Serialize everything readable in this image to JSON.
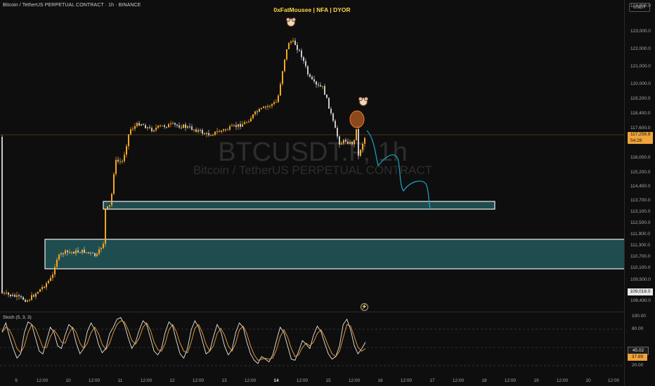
{
  "chart_header": {
    "symbol_title": "Bitcoin / TetherUS PERPETUAL CONTRACT · 1h · BINANCE",
    "author_header": "0xFatMousee | NFA | DYOR",
    "watermark_symbol": "BTCUSDT.P, 1h",
    "watermark_name": "Bitcoin / TetherUS PERPETUAL CONTRACT"
  },
  "price_axis": {
    "currency": "USDT",
    "ticks": [
      "124,000.0",
      "123,000.0",
      "122,000.0",
      "121,000.0",
      "120,000.0",
      "119,200.0",
      "118,400.0",
      "117,600.0",
      "116,800.0",
      "116,000.0",
      "115,200.0",
      "114,450.0",
      "113,700.0",
      "113,100.0",
      "112,500.0",
      "111,900.0",
      "111,300.0",
      "110,700.0",
      "110,100.0",
      "109,500.0",
      "108,430.0"
    ],
    "last_price": "117,256.8",
    "countdown": "54:28",
    "low_label": "109,018.0"
  },
  "stoch": {
    "title": "Stoch (5, 3, 3)",
    "ticks": [
      "100.00",
      "80.00",
      "20.00"
    ],
    "k_value": "45.02",
    "d_value": "37.89",
    "k_series": [
      72,
      88,
      62,
      40,
      22,
      30,
      70,
      90,
      85,
      60,
      35,
      30,
      55,
      80,
      70,
      45,
      40,
      65,
      85,
      78,
      50,
      30,
      40,
      72,
      88,
      75,
      48,
      32,
      40,
      68,
      80,
      95,
      98,
      85,
      60,
      40,
      52,
      75,
      92,
      85,
      60,
      35,
      28,
      40,
      70,
      90,
      82,
      55,
      30,
      22,
      40,
      75,
      92,
      80,
      55,
      30,
      35,
      62,
      85,
      72,
      45,
      28,
      38,
      70,
      88,
      80,
      52,
      30,
      18,
      12,
      25,
      20,
      15,
      28,
      55,
      80,
      70,
      45,
      20,
      18,
      35,
      55,
      48,
      40,
      65,
      82,
      72,
      50,
      30,
      20,
      25,
      45,
      85,
      95,
      75,
      45,
      30,
      40,
      52
    ],
    "d_series": [
      70,
      80,
      75,
      60,
      40,
      32,
      45,
      70,
      85,
      78,
      60,
      42,
      42,
      62,
      75,
      65,
      52,
      50,
      68,
      80,
      70,
      50,
      40,
      50,
      70,
      80,
      68,
      48,
      38,
      50,
      70,
      85,
      92,
      90,
      75,
      55,
      48,
      60,
      80,
      88,
      75,
      52,
      38,
      35,
      50,
      75,
      85,
      72,
      50,
      35,
      32,
      52,
      78,
      85,
      70,
      48,
      35,
      45,
      68,
      78,
      65,
      45,
      35,
      50,
      75,
      82,
      68,
      45,
      28,
      18,
      20,
      22,
      20,
      22,
      38,
      62,
      75,
      62,
      40,
      25,
      28,
      42,
      50,
      45,
      52,
      68,
      75,
      62,
      45,
      30,
      25,
      35,
      60,
      85,
      82,
      62,
      42,
      35,
      40
    ]
  },
  "time_axis": {
    "labels": [
      "9",
      "12:00",
      "10",
      "12:00",
      "11",
      "12:00",
      "12",
      "12:00",
      "13",
      "12:00",
      "14",
      "12:00",
      "15",
      "12:00",
      "16",
      "12:00",
      "17",
      "12:00",
      "18",
      "12:00",
      "19",
      "12:00",
      "20",
      "12:00"
    ],
    "bold_index": 10
  },
  "colors": {
    "up_candle": "#f5a623",
    "down_candle": "#c8c8c8",
    "zone_border": "#f0f0f0",
    "zone_fill": "#1f4d4f",
    "projection": "#1da6c4",
    "stoch_k": "#e8e8e8",
    "stoch_d": "#f0a43a"
  },
  "icons": [
    "mouse-icon",
    "lightning-icon"
  ]
}
